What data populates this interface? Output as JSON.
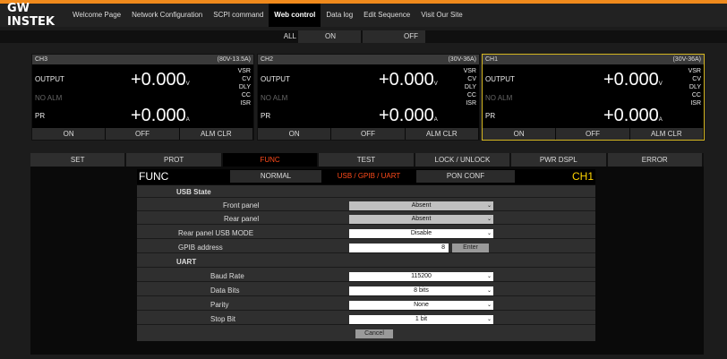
{
  "brand": {
    "logo": "GW INSTEK",
    "accent": "#f08a1c"
  },
  "nav": [
    "Welcome Page",
    "Network Configuration",
    "SCPI command",
    "Web control",
    "Data log",
    "Edit Sequence",
    "Visit Our Site"
  ],
  "nav_active": "Web control",
  "all_row": {
    "all": "ALL",
    "on": "ON",
    "off": "OFF"
  },
  "channels": [
    {
      "name": "CH3",
      "range": "(80V-13.5A)",
      "output": "OUTPUT",
      "alarm": "NO ALM",
      "pr": "PR",
      "voltage": "+0.000",
      "v_unit": "V",
      "current": "+0.000",
      "a_unit": "A",
      "stat1": "VSR",
      "stat2": "CV",
      "stat3": "DLY",
      "stat4": "CC",
      "stat5": "ISR",
      "btn_on": "ON",
      "btn_off": "OFF",
      "btn_clr": "ALM CLR"
    },
    {
      "name": "CH2",
      "range": "(30V-36A)",
      "output": "OUTPUT",
      "alarm": "NO ALM",
      "pr": "PR",
      "voltage": "+0.000",
      "v_unit": "V",
      "current": "+0.000",
      "a_unit": "A",
      "stat1": "VSR",
      "stat2": "CV",
      "stat3": "DLY",
      "stat4": "CC",
      "stat5": "ISR",
      "btn_on": "ON",
      "btn_off": "OFF",
      "btn_clr": "ALM CLR"
    },
    {
      "name": "CH1",
      "range": "(30V-36A)",
      "output": "OUTPUT",
      "alarm": "NO ALM",
      "pr": "PR",
      "voltage": "+0.000",
      "v_unit": "V",
      "current": "+0.000",
      "a_unit": "A",
      "stat1": "VSR",
      "stat2": "CV",
      "stat3": "DLY",
      "stat4": "CC",
      "stat5": "ISR",
      "btn_on": "ON",
      "btn_off": "OFF",
      "btn_clr": "ALM CLR"
    }
  ],
  "tabs": [
    "SET",
    "PROT",
    "FUNC",
    "TEST",
    "LOCK / UNLOCK",
    "PWR DSPL",
    "ERROR"
  ],
  "active_tab": "FUNC",
  "func": {
    "title": "FUNC",
    "subtabs": [
      "NORMAL",
      "USB / GPIB / UART",
      "PON CONF"
    ],
    "channel": "CH1",
    "usb_section": "USB State",
    "front_panel": {
      "label": "Front panel",
      "value": "Absent"
    },
    "rear_panel": {
      "label": "Rear panel",
      "value": "Absent"
    },
    "rear_usb_mode": {
      "label": "Rear panel USB MODE",
      "value": "Disable"
    },
    "gpib": {
      "label": "GPIB address",
      "value": "8",
      "enter": "Enter"
    },
    "uart_section": "UART",
    "baud": {
      "label": "Baud Rate",
      "value": "115200"
    },
    "data_bits": {
      "label": "Data Bits",
      "value": "8 bits"
    },
    "parity": {
      "label": "Parity",
      "value": "None"
    },
    "stop_bit": {
      "label": "Stop Bit",
      "value": "1 bit"
    },
    "cancel": "Cancel"
  }
}
